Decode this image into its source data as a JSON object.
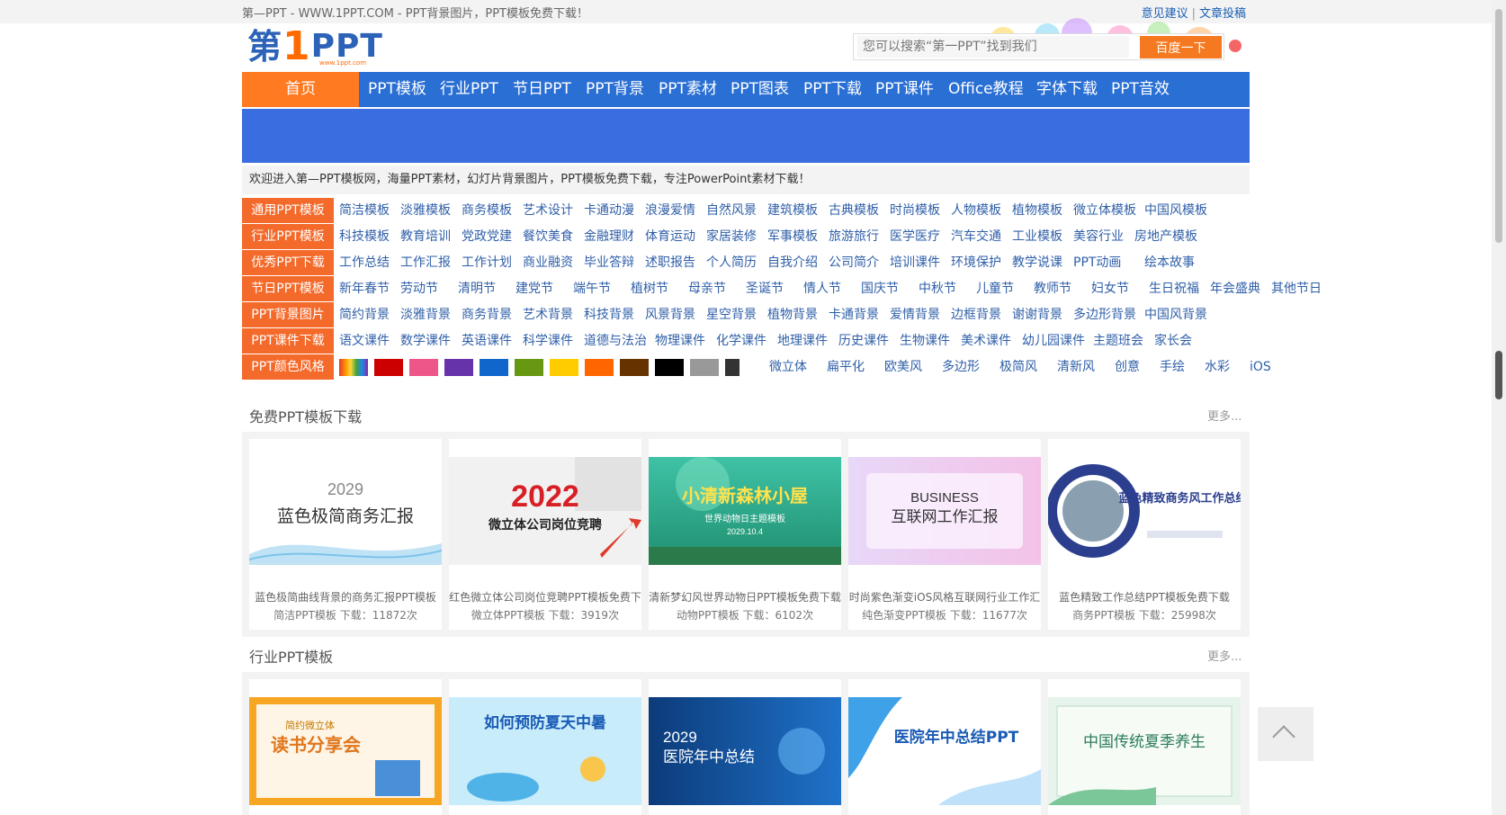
{
  "topbar": {
    "site_text": "第—PPT - WWW.1PPT.COM - PPT背景图片，PPT模板免费下载！",
    "link_feedback": "意见建议",
    "separator": "|",
    "link_submit": "文章投稿"
  },
  "logo": {
    "part1": "第",
    "part2": "1",
    "part3": "PPT",
    "small": "www.1ppt.com"
  },
  "search": {
    "placeholder": "您可以搜索“第一PPT”找到我们",
    "button": "百度一下"
  },
  "nav": {
    "home": "首页",
    "items": [
      "PPT模板",
      "行业PPT",
      "节日PPT",
      "PPT背景",
      "PPT素材",
      "PPT图表",
      "PPT下载",
      "PPT课件",
      "Office教程",
      "字体下载",
      "PPT音效"
    ]
  },
  "welcome": "欢迎进入第—PPT模板网，海量PPT素材，幻灯片背景图片，PPT模板免费下载，专注PowerPoint素材下载！",
  "categories": [
    {
      "label": "通用PPT模板",
      "links": [
        "简洁模板",
        "淡雅模板",
        "商务模板",
        "艺术设计",
        "卡通动漫",
        "浪漫爱情",
        "自然风景",
        "建筑模板",
        "古典模板",
        "时尚模板",
        "人物模板",
        "植物模板",
        "微立体模板",
        "中国风模板"
      ]
    },
    {
      "label": "行业PPT模板",
      "links": [
        "科技模板",
        "教育培训",
        "党政党建",
        "餐饮美食",
        "金融理财",
        "体育运动",
        "家居装修",
        "军事模板",
        "旅游旅行",
        "医学医疗",
        "汽车交通",
        "工业模板",
        "美容行业",
        "房地产模板"
      ]
    },
    {
      "label": "优秀PPT下载",
      "links": [
        "工作总结",
        "工作汇报",
        "工作计划",
        "商业融资",
        "毕业答辩",
        "述职报告",
        "个人简历",
        "自我介绍",
        "公司简介",
        "培训课件",
        "环境保护",
        "教学说课",
        "PPT动画",
        "绘本故事"
      ]
    },
    {
      "label": "节日PPT模板",
      "links": [
        "新年春节",
        "劳动节",
        "清明节",
        "建党节",
        "端午节",
        "植树节",
        "母亲节",
        "圣诞节",
        "情人节",
        "国庆节",
        "中秋节",
        "儿童节",
        "教师节",
        "妇女节",
        "生日祝福",
        "年会盛典",
        "其他节日"
      ]
    },
    {
      "label": "PPT背景图片",
      "links": [
        "简约背景",
        "淡雅背景",
        "商务背景",
        "艺术背景",
        "科技背景",
        "风景背景",
        "星空背景",
        "植物背景",
        "卡通背景",
        "爱情背景",
        "边框背景",
        "谢谢背景",
        "多边形背景",
        "中国风背景"
      ]
    },
    {
      "label": "PPT课件下载",
      "links": [
        "语文课件",
        "数学课件",
        "英语课件",
        "科学课件",
        "道德与法治",
        "物理课件",
        "化学课件",
        "地理课件",
        "历史课件",
        "生物课件",
        "美术课件",
        "幼儿园课件",
        "主题班会",
        "家长会"
      ]
    },
    {
      "label": "PPT颜色风格",
      "links": [
        "微立体",
        "扁平化",
        "欧美风",
        "多边形",
        "极简风",
        "清新风",
        "创意",
        "手绘",
        "水彩",
        "iOS"
      ]
    }
  ],
  "swatches": [
    "rainbow",
    "#cc0000",
    "#ee5588",
    "#6633aa",
    "#1166cc",
    "#669911",
    "#ffcc00",
    "#ff6600",
    "#663300",
    "#000000",
    "#999999",
    "bw"
  ],
  "section1": {
    "title": "免费PPT模板下载",
    "more": "更多...",
    "cards": [
      {
        "thumb_title": "蓝色极简商务汇报",
        "thumb_year": "2029",
        "title": "蓝色极简曲线背景的商务汇报PPT模板",
        "meta": "简洁PPT模板  下载：11872次"
      },
      {
        "thumb_title": "微立体公司岗位竞聘",
        "thumb_year": "2022",
        "title": "红色微立体公司岗位竞聘PPT模板免费下",
        "meta": "微立体PPT模板  下载：3919次"
      },
      {
        "thumb_title": "小清新森林小屋",
        "thumb_year": "2029.10.4",
        "thumb_sub": "世界动物日主题模板",
        "title": "清新梦幻风世界动物日PPT模板免费下载",
        "meta": "动物PPT模板  下载：6102次"
      },
      {
        "thumb_title": "互联网工作汇报",
        "thumb_year": "BUSINESS",
        "title": "时尚紫色渐变iOS风格互联网行业工作汇",
        "meta": "纯色渐变PPT模板  下载：11677次"
      },
      {
        "thumb_title": "蓝色精致商务风工作总结",
        "title": "蓝色精致工作总结PPT模板免费下载",
        "meta": "商务PPT模板  下载：25998次"
      }
    ]
  },
  "section2": {
    "title": "行业PPT模板",
    "more": "更多...",
    "cards": [
      {
        "thumb_title": "读书分享会",
        "thumb_sub": "简约微立体"
      },
      {
        "thumb_title": "如何预防夏天中暑"
      },
      {
        "thumb_title": "医院年中总结",
        "thumb_year": "2029"
      },
      {
        "thumb_title": "医院年中总结PPT"
      },
      {
        "thumb_title": "中国传统夏季养生"
      }
    ]
  }
}
